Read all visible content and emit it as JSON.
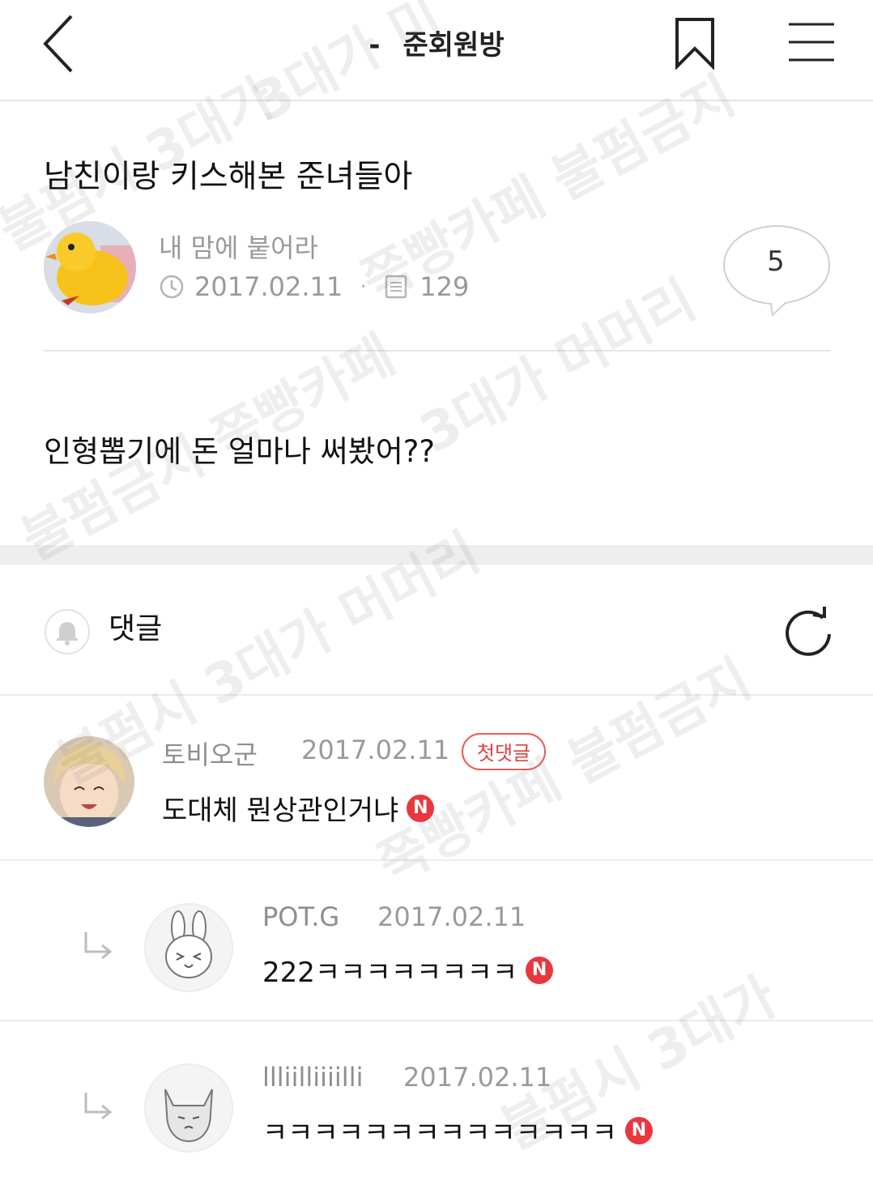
{
  "header": {
    "dash": "-",
    "title": "준회원방",
    "icons": {
      "back": "chevron-left-icon",
      "bookmark": "bookmark-icon",
      "menu": "hamburger-menu-icon"
    }
  },
  "post": {
    "title": "남친이랑 키스해본 준녀들아",
    "author": "내 맘에 붙어라",
    "date": "2017.02.11",
    "views": "129",
    "comment_count": "5",
    "body": "인형뽑기에 돈 얼마나 써봤어??"
  },
  "comments_section": {
    "label": "댓글"
  },
  "comments": [
    {
      "name": "토비오군",
      "date": "2017.02.11",
      "badge": "첫댓글",
      "text": "도대체 뭔상관인거냐",
      "new": "N"
    },
    {
      "name": "POT.G",
      "date": "2017.02.11",
      "text": "222ㅋㅋㅋㅋㅋㅋㅋㅋ",
      "new": "N"
    },
    {
      "name": "llliilliiiilli",
      "date": "2017.02.11",
      "text": "ㅋㅋㅋㅋㅋㅋㅋㅋㅋㅋㅋㅋㅋㅋ",
      "new": "N"
    }
  ],
  "watermark": [
    "3대가 미",
    "불펌시 3대가",
    "쭉빵카페 불펌금지",
    "불펌금지 쭉빵카페",
    "3대가 머머리",
    "불펌시 3대가 머머리",
    "쭉빵카페 불펌금지",
    "불펌시 3대가"
  ],
  "colors": {
    "accent_red": "#e8373f",
    "divider": "#ececec",
    "muted_text": "#9a9a9a"
  }
}
